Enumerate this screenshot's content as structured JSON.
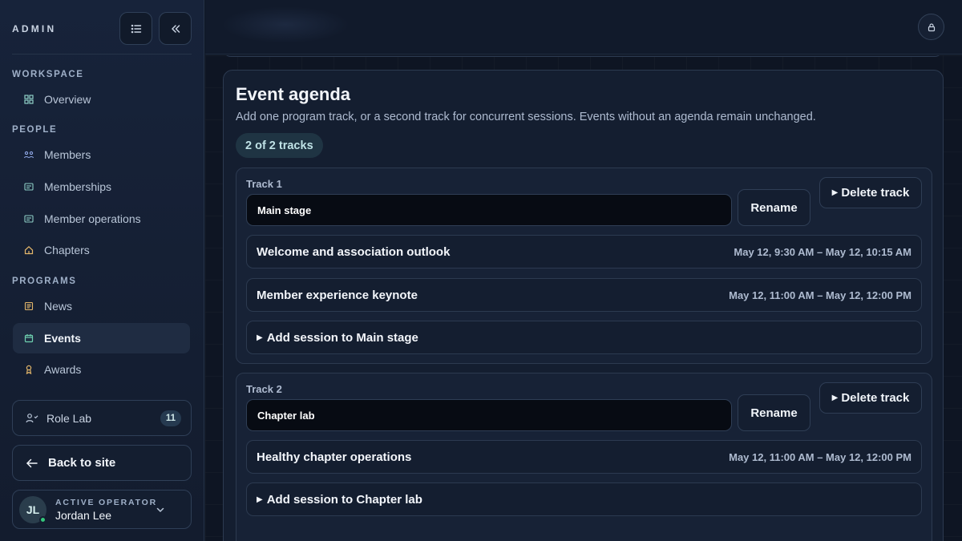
{
  "sidebar": {
    "brand": "ADMIN",
    "sections": {
      "workspace": "WORKSPACE",
      "people": "PEOPLE",
      "programs": "PROGRAMS"
    },
    "items": {
      "overview": "Overview",
      "members": "Members",
      "memberships": "Memberships",
      "member_operations": "Member operations",
      "chapters": "Chapters",
      "news": "News",
      "events": "Events",
      "awards": "Awards"
    },
    "active_item": "Events",
    "role_lab": {
      "label": "Role Lab",
      "count": "11"
    },
    "back_to_site": "Back to site",
    "operator": {
      "label": "ACTIVE OPERATOR",
      "name": "Jordan Lee",
      "initials": "JL"
    }
  },
  "agenda": {
    "title": "Event agenda",
    "description": "Add one program track, or a second track for concurrent sessions. Events without an agenda remain unchanged.",
    "track_count": "2 of 2 tracks",
    "tracks": [
      {
        "label": "Track 1",
        "name": "Main stage",
        "rename_label": "Rename",
        "delete_label": "Delete track",
        "sessions": [
          {
            "title": "Welcome and association outlook",
            "time": "May 12, 9:30 AM – May 12, 10:15 AM"
          },
          {
            "title": "Member experience keynote",
            "time": "May 12, 11:00 AM – May 12, 12:00 PM"
          }
        ],
        "add_session_label": "Add session to Main stage"
      },
      {
        "label": "Track 2",
        "name": "Chapter lab",
        "rename_label": "Rename",
        "delete_label": "Delete track",
        "sessions": [
          {
            "title": "Healthy chapter operations",
            "time": "May 12, 11:00 AM – May 12, 12:00 PM"
          }
        ],
        "add_session_label": "Add session to Chapter lab"
      }
    ]
  },
  "colors": {
    "background": "#0f1726",
    "sidebar": "#17233a",
    "card": "#141e30",
    "accent_badge": "#1f3443",
    "online": "#34c77b"
  },
  "icons": {
    "menu": "list-icon",
    "collapse": "double-chevron-left-icon",
    "lock": "lock-icon",
    "back": "arrow-left-icon",
    "operator_menu": "chevron-down-icon"
  }
}
